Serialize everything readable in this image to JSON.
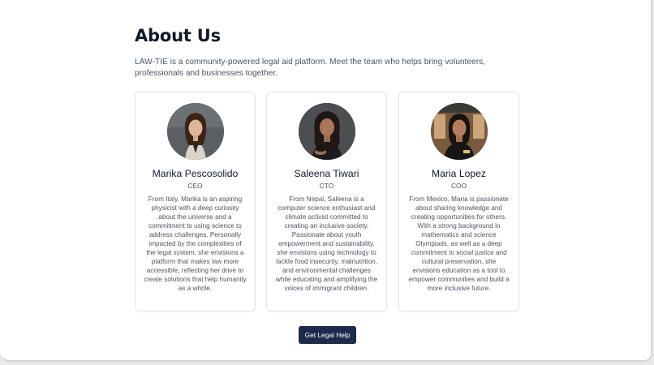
{
  "page": {
    "title": "About Us",
    "intro": "LAW-TIE is a community-powered legal aid platform. Meet the team who helps bring volunteers, professionals and businesses together."
  },
  "team": [
    {
      "name": "Marika Pescosolido",
      "role": "CEO",
      "bio": "From Italy, Marika is an aspiring physicist with a deep curiosity about the universe and a commitment to using science to address challenges. Personally impacted by the complexities of the legal system, she envisions a platform that makes law more accessible, reflecting her drive to create solutions that help humanity as a whole."
    },
    {
      "name": "Saleena Tiwari",
      "role": "CTO",
      "bio": "From Nepal, Saleena is a computer science enthusiast and climate activist committed to creating an inclusive society. Passionate about youth empowerment and sustainability, she envisions using technology to tackle food insecurity, malnutrition, and environmental challenges while educating and amplifying the voices of immigrant children."
    },
    {
      "name": "Maria Lopez",
      "role": "COO",
      "bio": "From Mexico, Maria is passionate about sharing knowledge and creating opportunities for others. With a strong background in mathematics and science Olympiads, as well as a deep commitment to social justice and cultural preservation, she envisions education as a tool to empower communities and build a more inclusive future."
    }
  ],
  "cta": {
    "label": "Get Legal Help"
  },
  "colors": {
    "heading": "#111827",
    "body_text": "#4b5563",
    "button_bg": "#1e2a4a",
    "card_border": "#e3e4e8"
  }
}
